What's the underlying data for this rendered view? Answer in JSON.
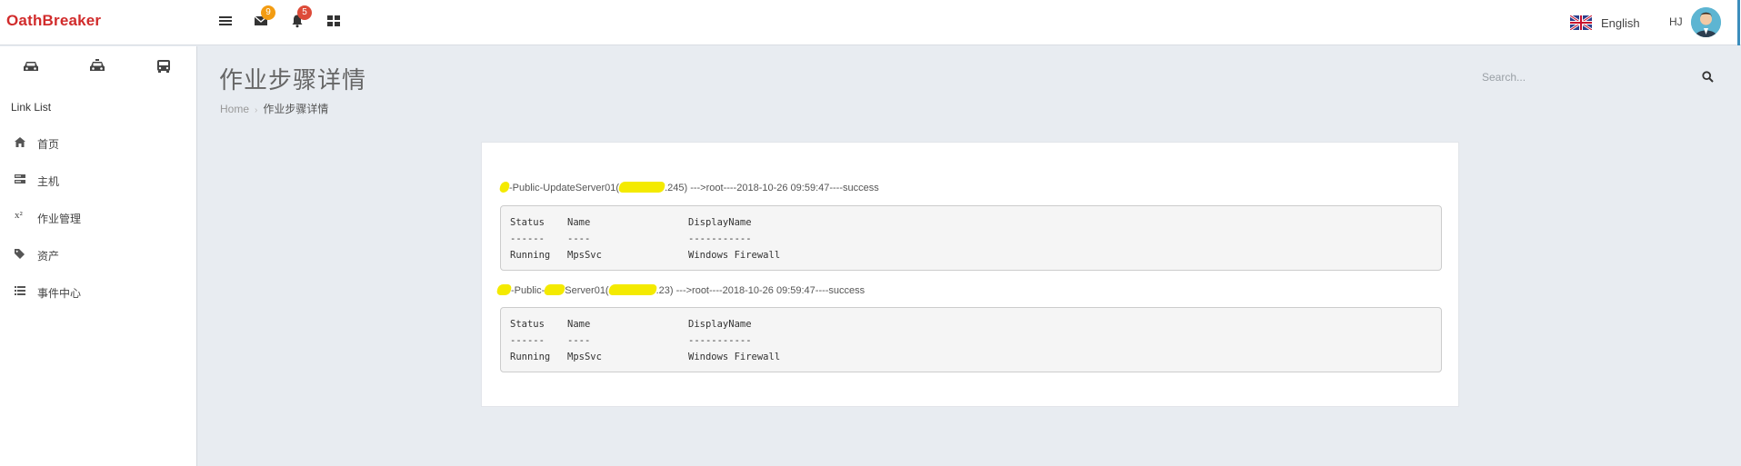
{
  "app": {
    "brand": "OathBreaker"
  },
  "topbar": {
    "menu_icon": "hamburger-icon",
    "mail": {
      "icon": "envelope-icon",
      "count": "9",
      "badge_color": "#f39c12"
    },
    "notifications": {
      "icon": "bell-icon",
      "count": "5",
      "badge_color": "#dd4b39"
    },
    "apps_icon": "grid-icon",
    "language": {
      "flag": "uk-flag-icon",
      "label": "English"
    },
    "user": {
      "initials": "HJ",
      "avatar": "user-avatar"
    },
    "accent_color": "#3c8dbc"
  },
  "sidebar": {
    "vehicles": [
      "car-icon",
      "taxi-icon",
      "bus-icon"
    ],
    "list_title": "Link List",
    "items": [
      {
        "icon": "home-icon",
        "label": "首页"
      },
      {
        "icon": "server-icon",
        "label": "主机"
      },
      {
        "icon": "superscript-icon",
        "label": "作业管理"
      },
      {
        "icon": "tag-icon",
        "label": "资产"
      },
      {
        "icon": "list-icon",
        "label": "事件中心"
      }
    ]
  },
  "header": {
    "title": "作业步骤详情",
    "breadcrumb": {
      "home": "Home",
      "separator": "›",
      "current": "作业步骤详情"
    },
    "search_placeholder": "Search..."
  },
  "steps": [
    {
      "host_prefix": "",
      "host_suffix": "-Public-UpdateServer01(",
      "ip_tail": ".245)",
      "info": " --->root----2018-10-26 09:59:47----success",
      "output": {
        "columns": [
          "Status",
          "Name",
          "DisplayName"
        ],
        "separators": [
          "------",
          "----",
          "-----------"
        ],
        "rows": [
          [
            "Running",
            "MpsSvc",
            "Windows Firewall"
          ]
        ]
      }
    },
    {
      "host_prefix": "",
      "host_suffix": "-Public-",
      "host_mid": "Server01(",
      "ip_tail": ".23)",
      "info": " --->root----2018-10-26 09:59:47----success",
      "output": {
        "columns": [
          "Status",
          "Name",
          "DisplayName"
        ],
        "separators": [
          "------",
          "----",
          "-----------"
        ],
        "rows": [
          [
            "Running",
            "MpsSvc",
            "Windows Firewall"
          ]
        ]
      }
    }
  ],
  "redaction_color": "#f4ea00"
}
